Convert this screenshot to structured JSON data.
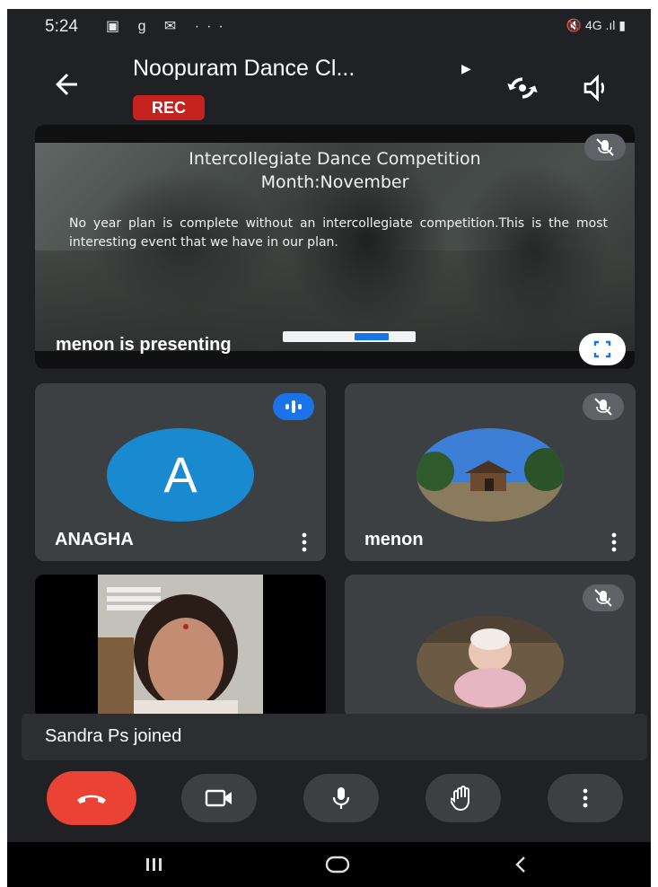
{
  "status_bar": {
    "time": "5:24",
    "left_icons": "▣ g ✉ ···",
    "right_icons": "🔇 4G .ıl ▮"
  },
  "header": {
    "title": "Noopuram Dance Cl...",
    "rec_label": "REC"
  },
  "presentation": {
    "slide_title": "Intercollegiate Dance Competition",
    "slide_subtitle": "Month:November",
    "slide_body": "No year plan is complete without an intercollegiate competition.This is the most interesting event that we have in our plan.",
    "presenting_label": "menon is presenting"
  },
  "participants": [
    {
      "name": "ANAGHA",
      "avatar_letter": "A",
      "avatar_color": "#1a8ad0",
      "state": "speaking"
    },
    {
      "name": "menon",
      "state": "muted"
    },
    {
      "name": "",
      "state": "camera-on"
    },
    {
      "name": "",
      "state": "muted"
    }
  ],
  "toast": {
    "text": "Sandra Ps joined"
  },
  "controls": [
    "end-call",
    "camera",
    "microphone",
    "raise-hand",
    "more-options"
  ],
  "colors": {
    "end_call": "#ea4335",
    "rec": "#c5221f",
    "accent_blue": "#1a73e8"
  }
}
